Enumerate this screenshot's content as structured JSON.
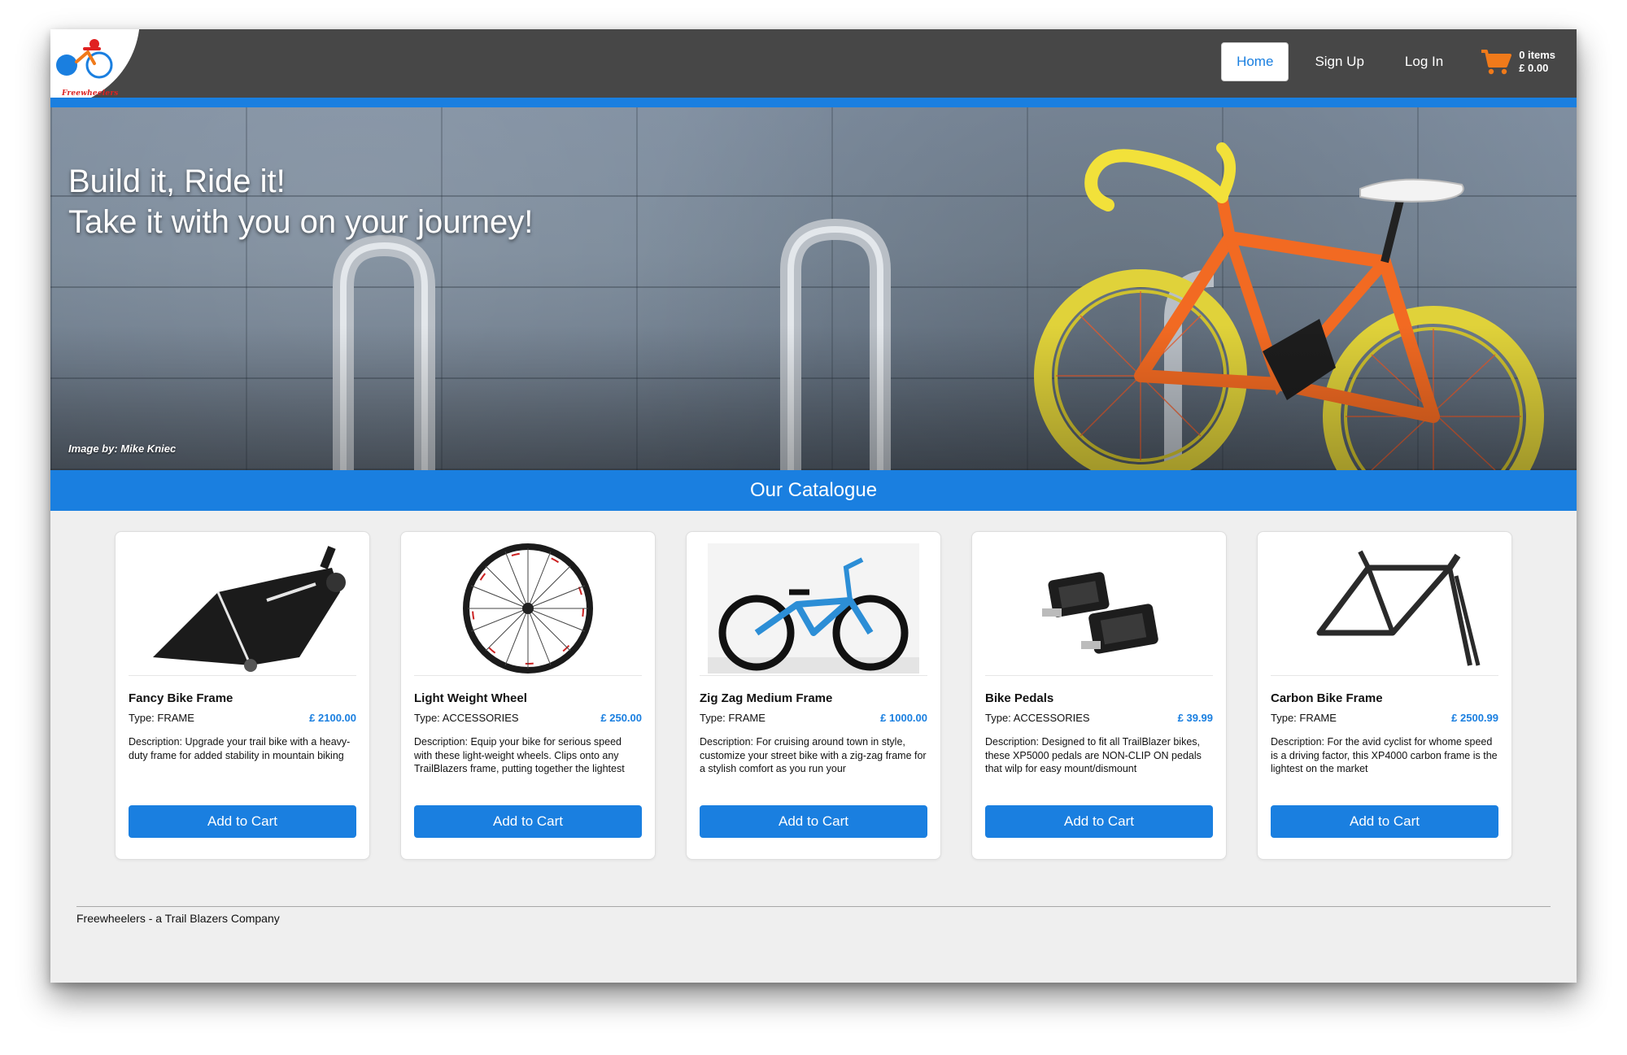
{
  "brand": {
    "logo_text": "Freewheelers"
  },
  "nav": {
    "home": "Home",
    "sign_up": "Sign Up",
    "log_in": "Log In",
    "cart_items": "0 items",
    "cart_total": "£ 0.00"
  },
  "hero": {
    "line1": "Build it, Ride it!",
    "line2": "Take it with you on your journey!",
    "credit": "Image by: Mike Kniec"
  },
  "catalogue": {
    "title": "Our Catalogue",
    "products": [
      {
        "name": "Fancy Bike Frame",
        "type": "Type: FRAME",
        "price": "£ 2100.00",
        "description": "Description: Upgrade your trail bike with a heavy-duty frame for added stability in mountain biking",
        "button": "Add to Cart",
        "image_icon": "bike-frame-icon"
      },
      {
        "name": "Light Weight Wheel",
        "type": "Type: ACCESSORIES",
        "price": "£ 250.00",
        "description": "Description: Equip your bike for serious speed with these light-weight wheels. Clips onto any TrailBlazers frame, putting together the lightest",
        "button": "Add to Cart",
        "image_icon": "wheel-icon"
      },
      {
        "name": "Zig Zag Medium Frame",
        "type": "Type: FRAME",
        "price": "£ 1000.00",
        "description": "Description: For cruising around town in style, customize your street bike with a zig-zag frame for a stylish comfort as you run your",
        "button": "Add to Cart",
        "image_icon": "bmx-bike-icon"
      },
      {
        "name": "Bike Pedals",
        "type": "Type: ACCESSORIES",
        "price": "£ 39.99",
        "description": "Description: Designed to fit all TrailBlazer bikes, these XP5000 pedals are NON-CLIP ON pedals that wilp for easy mount/dismount",
        "button": "Add to Cart",
        "image_icon": "pedals-icon"
      },
      {
        "name": "Carbon Bike Frame",
        "type": "Type: FRAME",
        "price": "£ 2500.99",
        "description": "Description: For the avid cyclist for whome speed is a driving factor, this XP4000 carbon frame is the lightest on the market",
        "button": "Add to Cart",
        "image_icon": "road-frame-icon"
      }
    ]
  },
  "footer": {
    "text": "Freewheelers - a Trail Blazers Company"
  },
  "colors": {
    "accent": "#1a7fe0",
    "navbar": "#474747",
    "cart": "#f07a1a",
    "page_bg": "#efefef"
  }
}
